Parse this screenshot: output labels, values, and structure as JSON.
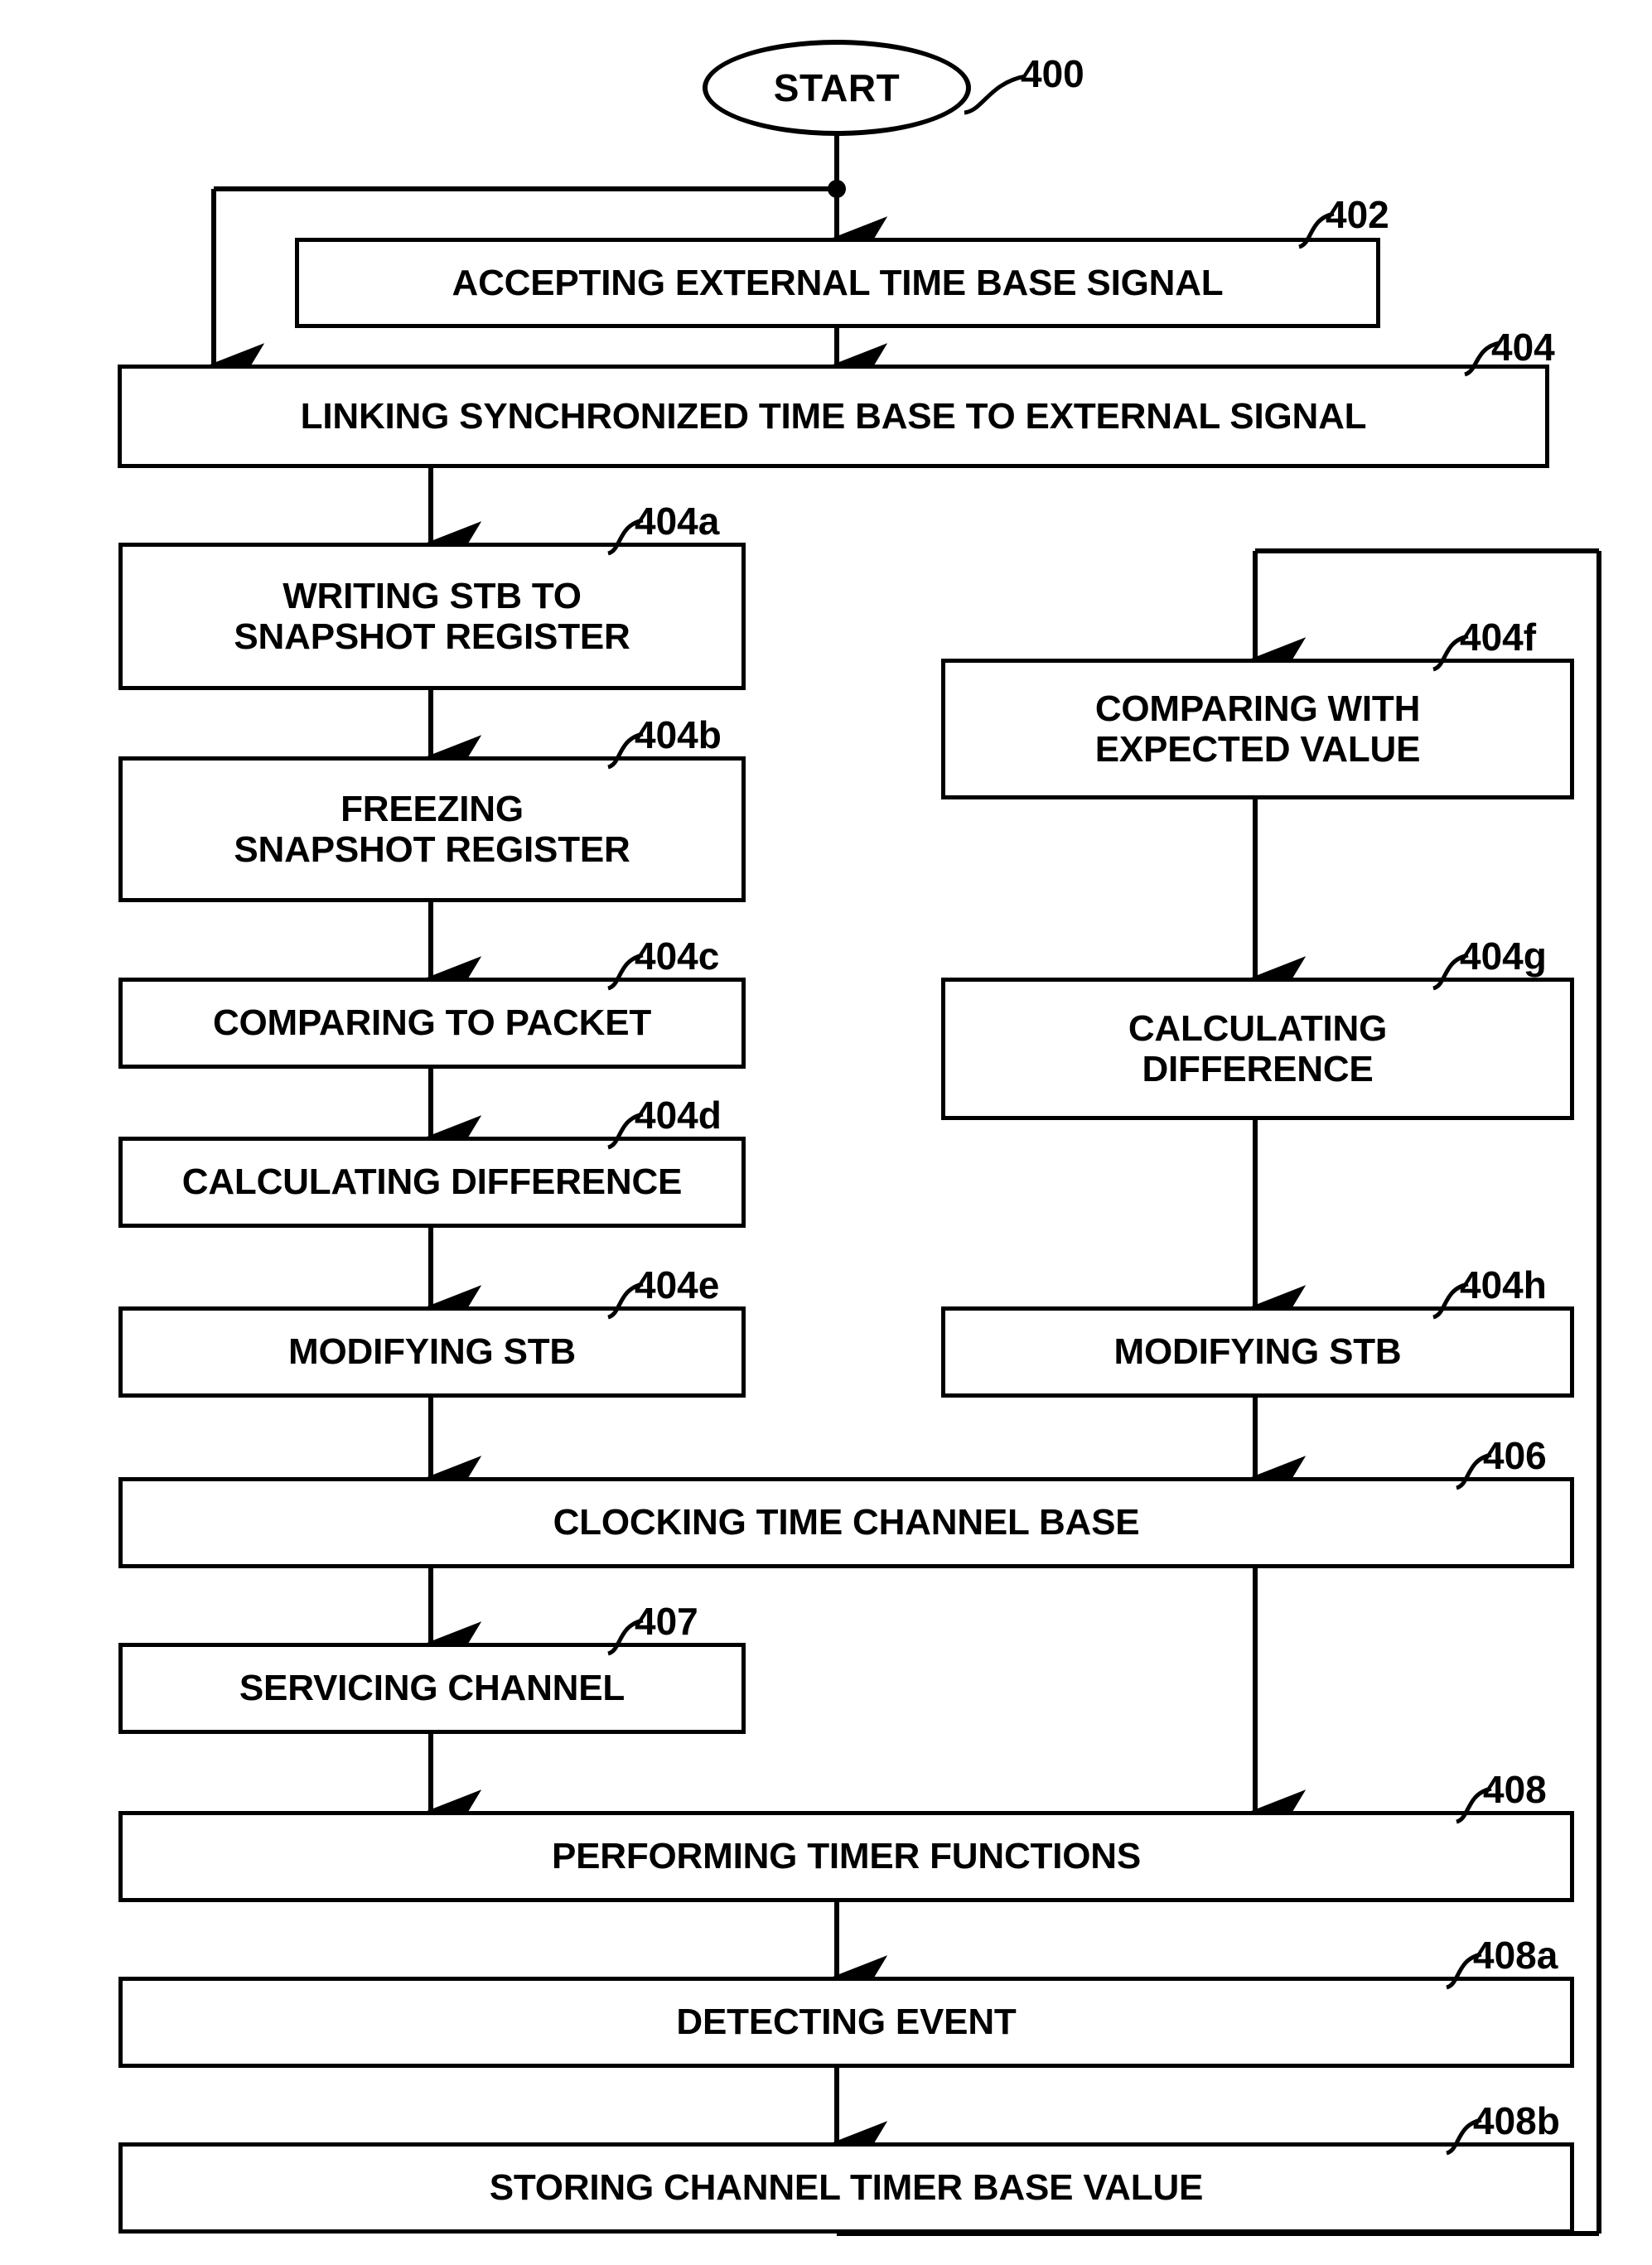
{
  "figure": {
    "type": "patent-flowchart",
    "terminal": {
      "label": "START",
      "ref": "400"
    },
    "nodes": [
      {
        "id": "n402",
        "ref": "402",
        "label": "ACCEPTING EXTERNAL TIME BASE SIGNAL"
      },
      {
        "id": "n404",
        "ref": "404",
        "label": "LINKING SYNCHRONIZED TIME BASE TO EXTERNAL SIGNAL"
      },
      {
        "id": "n404a",
        "ref": "404a",
        "label": "WRITING STB TO\nSNAPSHOT REGISTER"
      },
      {
        "id": "n404b",
        "ref": "404b",
        "label": "FREEZING\nSNAPSHOT REGISTER"
      },
      {
        "id": "n404c",
        "ref": "404c",
        "label": "COMPARING TO PACKET"
      },
      {
        "id": "n404d",
        "ref": "404d",
        "label": "CALCULATING DIFFERENCE"
      },
      {
        "id": "n404e",
        "ref": "404e",
        "label": "MODIFYING STB"
      },
      {
        "id": "n404f",
        "ref": "404f",
        "label": "COMPARING WITH\nEXPECTED VALUE"
      },
      {
        "id": "n404g",
        "ref": "404g",
        "label": "CALCULATING\nDIFFERENCE"
      },
      {
        "id": "n404h",
        "ref": "404h",
        "label": "MODIFYING STB"
      },
      {
        "id": "n406",
        "ref": "406",
        "label": "CLOCKING TIME CHANNEL BASE"
      },
      {
        "id": "n407",
        "ref": "407",
        "label": "SERVICING CHANNEL"
      },
      {
        "id": "n408",
        "ref": "408",
        "label": "PERFORMING TIMER FUNCTIONS"
      },
      {
        "id": "n408a",
        "ref": "408a",
        "label": "DETECTING EVENT"
      },
      {
        "id": "n408b",
        "ref": "408b",
        "label": "STORING CHANNEL TIMER BASE VALUE"
      }
    ],
    "colors": {
      "stroke": "#000000",
      "fill": "#ffffff"
    }
  }
}
